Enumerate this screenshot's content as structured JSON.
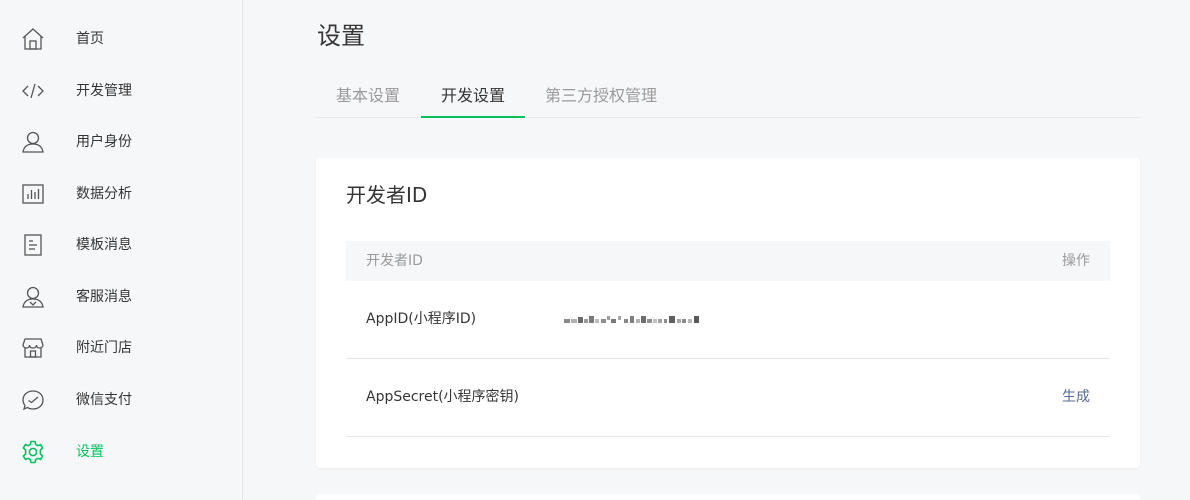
{
  "sidebar": {
    "items": [
      {
        "label": "首页",
        "icon": "home-icon"
      },
      {
        "label": "开发管理",
        "icon": "code-icon"
      },
      {
        "label": "用户身份",
        "icon": "user-icon"
      },
      {
        "label": "数据分析",
        "icon": "chart-icon"
      },
      {
        "label": "模板消息",
        "icon": "document-icon"
      },
      {
        "label": "客服消息",
        "icon": "customer-service-icon"
      },
      {
        "label": "附近门店",
        "icon": "store-icon"
      },
      {
        "label": "微信支付",
        "icon": "wechat-pay-icon"
      },
      {
        "label": "设置",
        "icon": "gear-icon",
        "active": true
      }
    ]
  },
  "main": {
    "title": "设置",
    "tabs": [
      {
        "label": "基本设置"
      },
      {
        "label": "开发设置",
        "active": true
      },
      {
        "label": "第三方授权管理"
      }
    ]
  },
  "developer_card": {
    "title": "开发者ID",
    "table": {
      "headers": {
        "name": "开发者ID",
        "action": "操作"
      },
      "rows": [
        {
          "name": "AppID(小程序ID)",
          "value_masked": true,
          "action": ""
        },
        {
          "name": "AppSecret(小程序密钥)",
          "value_masked": false,
          "action": "生成"
        }
      ]
    }
  },
  "colors": {
    "accent": "#07c160",
    "link": "#576b95",
    "muted": "#9a9a9a"
  }
}
